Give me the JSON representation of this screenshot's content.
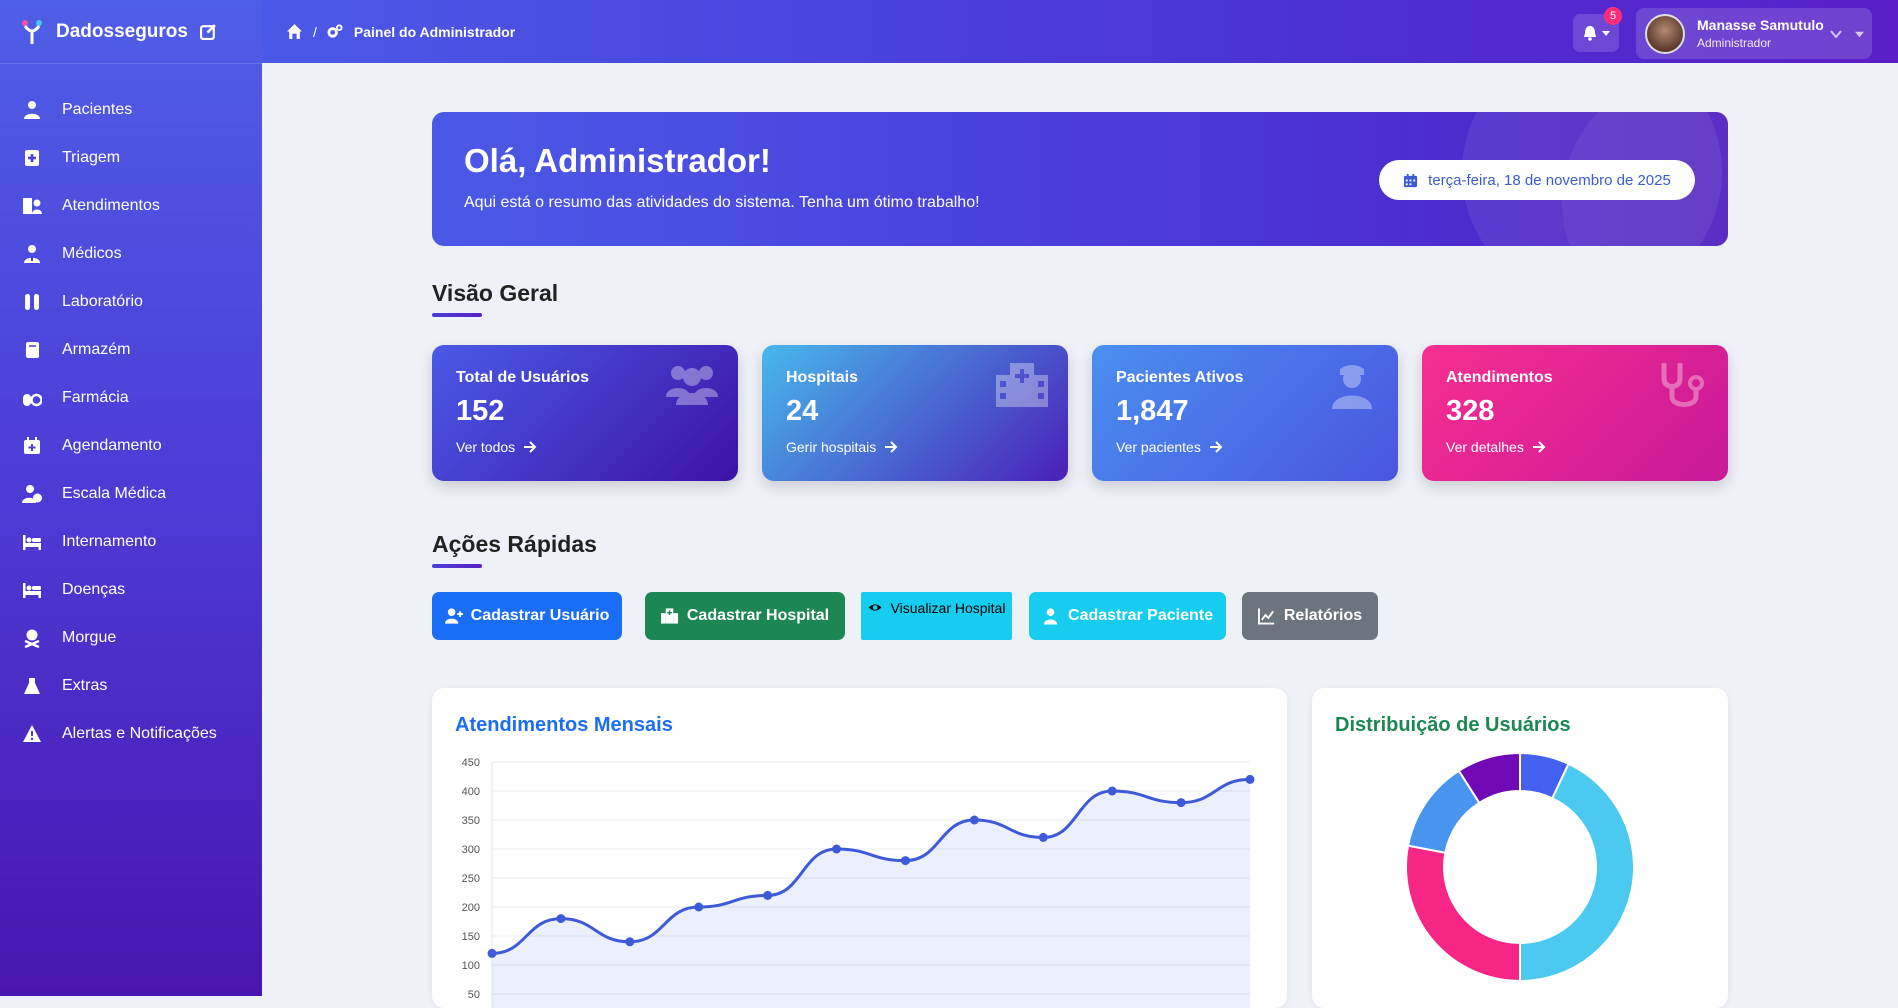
{
  "sidebar": {
    "brand": "Dadosseguros",
    "items": [
      {
        "label": "Pacientes",
        "icon": "user-injured-icon"
      },
      {
        "label": "Triagem",
        "icon": "notes-medical-icon"
      },
      {
        "label": "Atendimentos",
        "icon": "hospital-user-icon"
      },
      {
        "label": "Médicos",
        "icon": "user-md-icon"
      },
      {
        "label": "Laboratório",
        "icon": "vials-icon"
      },
      {
        "label": "Armazém",
        "icon": "book-icon"
      },
      {
        "label": "Farmácia",
        "icon": "pills-icon"
      },
      {
        "label": "Agendamento",
        "icon": "calendar-plus-icon"
      },
      {
        "label": "Escala Médica",
        "icon": "user-clock-icon"
      },
      {
        "label": "Internamento",
        "icon": "bed-icon"
      },
      {
        "label": "Doenças",
        "icon": "procedures-icon"
      },
      {
        "label": "Morgue",
        "icon": "skull-crossbones-icon"
      },
      {
        "label": "Extras",
        "icon": "flask-icon"
      },
      {
        "label": "Alertas e Notificações",
        "icon": "warning-icon"
      }
    ]
  },
  "header": {
    "breadcrumb_sep": "/",
    "breadcrumb": "Painel do Administrador",
    "notification_count": "5",
    "user_name": "Manasse Samutulo",
    "user_role": "Administrador"
  },
  "welcome": {
    "title": "Olá, Administrador!",
    "subtitle": "Aqui está o resumo das atividades do sistema. Tenha um ótimo trabalho!",
    "date": "terça-feira, 18 de novembro de 2025"
  },
  "overview": {
    "title": "Visão Geral",
    "cards": [
      {
        "label": "Total de Usuários",
        "value": "152",
        "link": "Ver todos",
        "icon": "users-icon",
        "color_from": "#4a5ae6",
        "color_to": "#3d12a6"
      },
      {
        "label": "Hospitais",
        "value": "24",
        "link": "Gerir hospitais",
        "icon": "hospital-icon",
        "color_from": "#48b8ec",
        "color_to": "#4a1fb8"
      },
      {
        "label": "Pacientes Ativos",
        "value": "1,847",
        "link": "Ver pacientes",
        "icon": "user-nurse-icon",
        "color_from": "#4a8ff0",
        "color_to": "#4a55e0"
      },
      {
        "label": "Atendimentos",
        "value": "328",
        "link": "Ver detalhes",
        "icon": "stethoscope-icon",
        "color_from": "#f72f8f",
        "color_to": "#c8189a"
      }
    ]
  },
  "quick_actions": {
    "title": "Ações Rápidas",
    "buttons": [
      {
        "label": "Cadastrar Usuário",
        "color": "#1a6ef5"
      },
      {
        "label": "Cadastrar Hospital",
        "color": "#1c8752"
      },
      {
        "label": "Visualizar Hospital",
        "color": "#16cdf0"
      },
      {
        "label": "Cadastrar Paciente",
        "color": "#16cdf0"
      },
      {
        "label": "Relatórios",
        "color": "#6c757d"
      }
    ]
  },
  "line_panel": {
    "title": "Atendimentos Mensais",
    "title_color": "#1a6ef5"
  },
  "donut_panel": {
    "title": "Distribuição de Usuários",
    "title_color": "#1c8752"
  },
  "chart_data": [
    {
      "type": "line",
      "title": "Atendimentos Mensais",
      "x": [
        1,
        2,
        3,
        4,
        5,
        6,
        7,
        8,
        9,
        10,
        11,
        12
      ],
      "values": [
        120,
        180,
        140,
        200,
        220,
        300,
        280,
        350,
        320,
        400,
        380,
        420
      ],
      "ylim": [
        50,
        450
      ],
      "yticks": [
        450,
        400,
        350,
        300,
        250,
        200,
        150,
        100,
        50
      ],
      "grid": true,
      "color": "#3d5bd9"
    },
    {
      "type": "pie",
      "title": "Distribuição de Usuários",
      "values": [
        7,
        43,
        28,
        13,
        9
      ],
      "colors": [
        "#4361ee",
        "#4cc9f0",
        "#f72585",
        "#4895ef",
        "#7209b7"
      ]
    }
  ]
}
